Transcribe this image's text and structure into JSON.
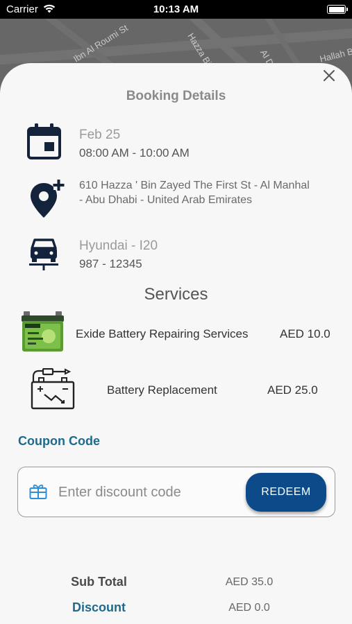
{
  "status_bar": {
    "carrier": "Carrier",
    "time": "10:13 AM"
  },
  "map": {
    "streets": [
      "Ibn Al Roumi St",
      "Hazza Bin Saeed St",
      "Al Dafra",
      "Hallah B"
    ]
  },
  "booking": {
    "title": "Booking Details",
    "date": "Feb 25",
    "time_range": "08:00 AM - 10:00 AM",
    "address": "610 Hazza ' Bin Zayed The First St - Al Manhal - Abu Dhabi - United Arab Emirates",
    "vehicle": "Hyundai - I20",
    "plate": "987 - 12345"
  },
  "services": {
    "heading": "Services",
    "items": [
      {
        "name": "Exide Battery Repairing Services",
        "price": "AED 10.0",
        "icon": "battery-product-icon"
      },
      {
        "name": "Battery Replacement",
        "price": "AED 25.0",
        "icon": "battery-replacement-icon"
      }
    ]
  },
  "coupon": {
    "label": "Coupon Code",
    "placeholder": "Enter discount code",
    "value": "",
    "button": "REDEEM"
  },
  "totals": {
    "subtotal_label": "Sub Total",
    "subtotal_value": "AED 35.0",
    "discount_label": "Discount",
    "discount_value": "AED 0.0"
  },
  "colors": {
    "accent": "#0d4a8a",
    "coupon_label": "#1d6a8c",
    "icon_dark": "#14233c"
  }
}
